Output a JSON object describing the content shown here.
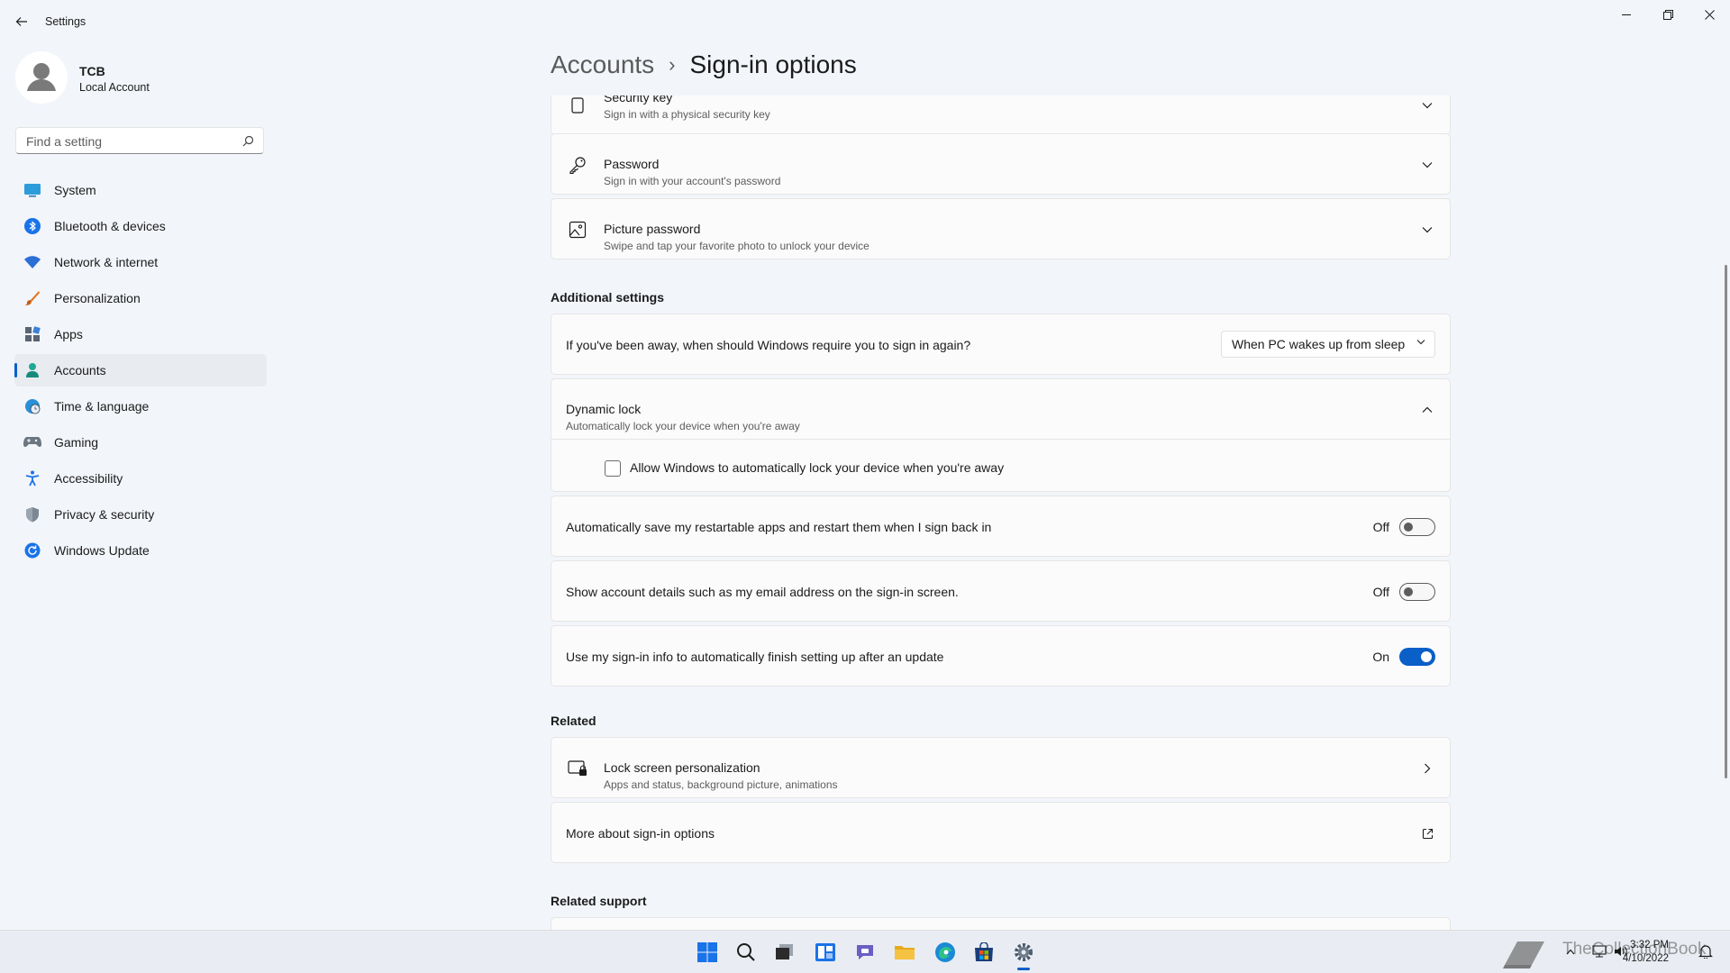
{
  "window": {
    "app_title": "Settings",
    "controls": [
      "minimize",
      "restore",
      "close"
    ]
  },
  "profile": {
    "name": "TCB",
    "account_type": "Local Account"
  },
  "search": {
    "placeholder": "Find a setting"
  },
  "sidebar": {
    "items": [
      {
        "label": "System",
        "icon": "system-icon",
        "active": false
      },
      {
        "label": "Bluetooth & devices",
        "icon": "bluetooth-icon",
        "active": false
      },
      {
        "label": "Network & internet",
        "icon": "wifi-icon",
        "active": false
      },
      {
        "label": "Personalization",
        "icon": "brush-icon",
        "active": false
      },
      {
        "label": "Apps",
        "icon": "apps-icon",
        "active": false
      },
      {
        "label": "Accounts",
        "icon": "accounts-icon",
        "active": true
      },
      {
        "label": "Time & language",
        "icon": "globe-clock-icon",
        "active": false
      },
      {
        "label": "Gaming",
        "icon": "gamepad-icon",
        "active": false
      },
      {
        "label": "Accessibility",
        "icon": "accessibility-icon",
        "active": false
      },
      {
        "label": "Privacy & security",
        "icon": "shield-icon",
        "active": false
      },
      {
        "label": "Windows Update",
        "icon": "update-icon",
        "active": false
      }
    ]
  },
  "breadcrumb": {
    "parent": "Accounts",
    "separator": "›",
    "current": "Sign-in options"
  },
  "signin_methods": [
    {
      "title": "Security key",
      "desc": "Sign in with a physical security key",
      "icon": "usb-key-icon"
    },
    {
      "title": "Password",
      "desc": "Sign in with your account's password",
      "icon": "key-icon"
    },
    {
      "title": "Picture password",
      "desc": "Swipe and tap your favorite photo to unlock your device",
      "icon": "picture-icon"
    }
  ],
  "additional_settings": {
    "heading": "Additional settings",
    "require_signin": {
      "label": "If you've been away, when should Windows require you to sign in again?",
      "selected": "When PC wakes up from sleep"
    },
    "dynamic_lock": {
      "title": "Dynamic lock",
      "desc": "Automatically lock your device when you're away",
      "checkbox_label": "Allow Windows to automatically lock your device when you're away",
      "checked": false
    },
    "toggles": [
      {
        "label": "Automatically save my restartable apps and restart them when I sign back in",
        "state": "Off",
        "on": false
      },
      {
        "label": "Show account details such as my email address on the sign-in screen.",
        "state": "Off",
        "on": false
      },
      {
        "label": "Use my sign-in info to automatically finish setting up after an update",
        "state": "On",
        "on": true
      }
    ]
  },
  "related": {
    "heading": "Related",
    "lock_screen": {
      "title": "Lock screen personalization",
      "desc": "Apps and status, background picture, animations"
    },
    "more_about": {
      "title": "More about sign-in options"
    }
  },
  "related_support": {
    "heading": "Related support"
  },
  "taskbar": {
    "apps": [
      "start-icon",
      "search-icon",
      "task-view-icon",
      "widgets-icon",
      "chat-icon",
      "file-explorer-icon",
      "edge-icon",
      "store-icon",
      "settings-icon"
    ],
    "active_app": "settings-icon",
    "time": "3:32 PM",
    "date": "4/10/2022",
    "watermark": "TheCollectionBook"
  },
  "colors": {
    "accent": "#0a5fc8",
    "background": "#f2f5fa",
    "card": "#fbfbfc"
  }
}
